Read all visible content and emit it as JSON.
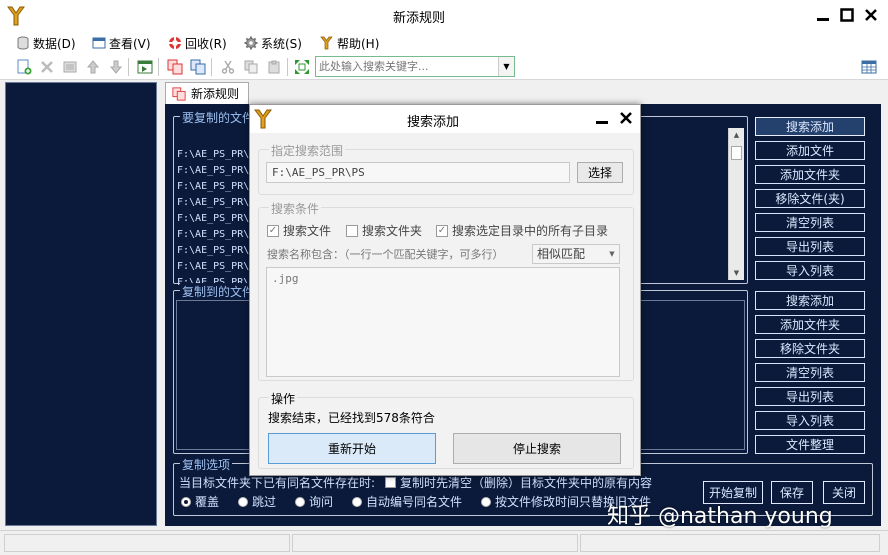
{
  "window": {
    "title": "新添规则"
  },
  "menu": [
    {
      "label": "数据(D)",
      "icon": "database-icon"
    },
    {
      "label": "查看(V)",
      "icon": "view-icon"
    },
    {
      "label": "回收(R)",
      "icon": "lifebuoy-icon"
    },
    {
      "label": "系统(S)",
      "icon": "gear-icon"
    },
    {
      "label": "帮助(H)",
      "icon": "help-icon"
    }
  ],
  "toolbar": {
    "search_placeholder": "此处输入搜索关键字..."
  },
  "tab": {
    "label": "新添规则"
  },
  "main": {
    "source_group_title": "要复制的文件",
    "source_items": [
      "F:\\AE_PS_PR\\",
      "F:\\AE_PS_PR\\",
      "F:\\AE_PS_PR\\",
      "F:\\AE_PS_PR\\",
      "F:\\AE_PS_PR\\",
      "F:\\AE_PS_PR\\",
      "F:\\AE_PS_PR\\",
      "F:\\AE_PS_PR\\",
      "F:\\AE_PS_PR\\"
    ],
    "source_buttons": [
      "搜索添加",
      "添加文件",
      "添加文件夹",
      "移除文件(夹)",
      "清空列表",
      "导出列表",
      "导入列表"
    ],
    "dest_group_title": "复制到的文件",
    "dest_buttons": [
      "搜索添加",
      "添加文件夹",
      "移除文件夹",
      "清空列表",
      "导出列表",
      "导入列表",
      "文件整理"
    ],
    "options": {
      "title": "复制选项",
      "existing_label": "当目标文件夹下已有同名文件存在时:",
      "clear_label": "复制时先清空（删除）目标文件夹中的原有内容",
      "radios": [
        "覆盖",
        "跳过",
        "询问",
        "自动编号同名文件",
        "按文件修改时间只替换旧文件"
      ],
      "selected": "覆盖"
    },
    "action_buttons": [
      "开始复制",
      "保存",
      "关闭"
    ]
  },
  "dialog": {
    "title": "搜索添加",
    "scope_title": "指定搜索范围",
    "scope_path": "F:\\AE_PS_PR\\PS",
    "choose_label": "选择",
    "cond_title": "搜索条件",
    "check_files": "搜索文件",
    "check_folders": "搜索文件夹",
    "check_subdirs": "搜索选定目录中的所有子目录",
    "name_label": "搜索名称包含：（一行一个匹配关键字，可多行）",
    "match_mode": "相似匹配",
    "keywords": ".jpg",
    "op_title": "操作",
    "status": "搜索结束，已经找到578条符合",
    "restart_label": "重新开始",
    "stop_label": "停止搜索"
  },
  "watermark": "知乎 @nathan young",
  "colors": {
    "panel_bg": "#0b1a3a",
    "panel_text": "#cfe0ff",
    "primary_btn": "#dbeaf9"
  }
}
